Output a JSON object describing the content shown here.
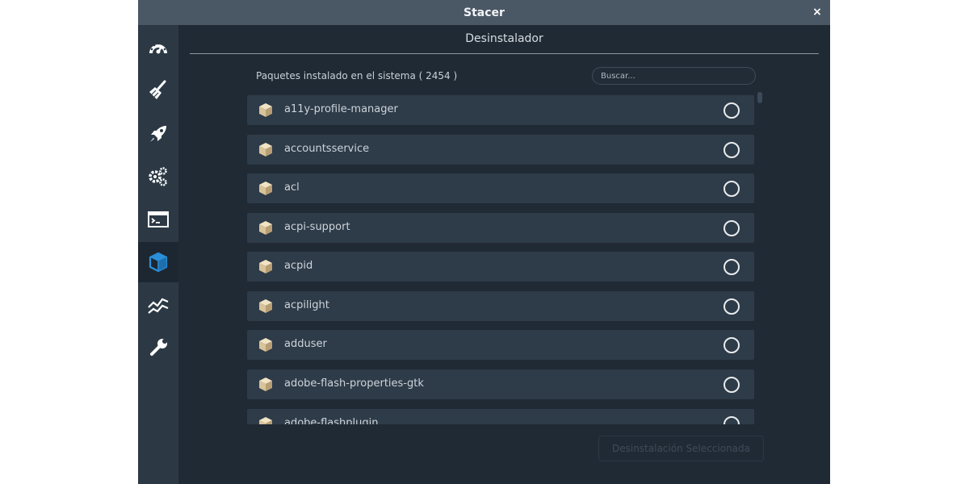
{
  "window": {
    "title": "Stacer",
    "close_glyph": "×"
  },
  "sidebar": {
    "items": [
      {
        "icon": "dashboard-icon",
        "active": false
      },
      {
        "icon": "broom-icon",
        "active": false
      },
      {
        "icon": "rocket-icon",
        "active": false
      },
      {
        "icon": "gears-icon",
        "active": false
      },
      {
        "icon": "terminal-icon",
        "active": false
      },
      {
        "icon": "package-icon",
        "active": true
      },
      {
        "icon": "chart-line-icon",
        "active": false
      },
      {
        "icon": "wrench-icon",
        "active": false
      }
    ]
  },
  "header": {
    "title": "Desinstalador"
  },
  "packages": {
    "count_label": "Paquetes instalado en el sistema ( 2454 )",
    "search_placeholder": "Buscar...",
    "items": [
      {
        "name": "a11y-profile-manager",
        "selected": false
      },
      {
        "name": "accountsservice",
        "selected": false
      },
      {
        "name": "acl",
        "selected": false
      },
      {
        "name": "acpi-support",
        "selected": false
      },
      {
        "name": "acpid",
        "selected": false
      },
      {
        "name": "acpilight",
        "selected": false
      },
      {
        "name": "adduser",
        "selected": false
      },
      {
        "name": "adobe-flash-properties-gtk",
        "selected": false
      },
      {
        "name": "adobe-flashplugin",
        "selected": false
      }
    ]
  },
  "actions": {
    "uninstall_label": "Desinstalación Seleccionada"
  },
  "colors": {
    "accent": "#2a8fd8",
    "window_bg": "#202a35",
    "row_bg": "#2e3b48"
  }
}
